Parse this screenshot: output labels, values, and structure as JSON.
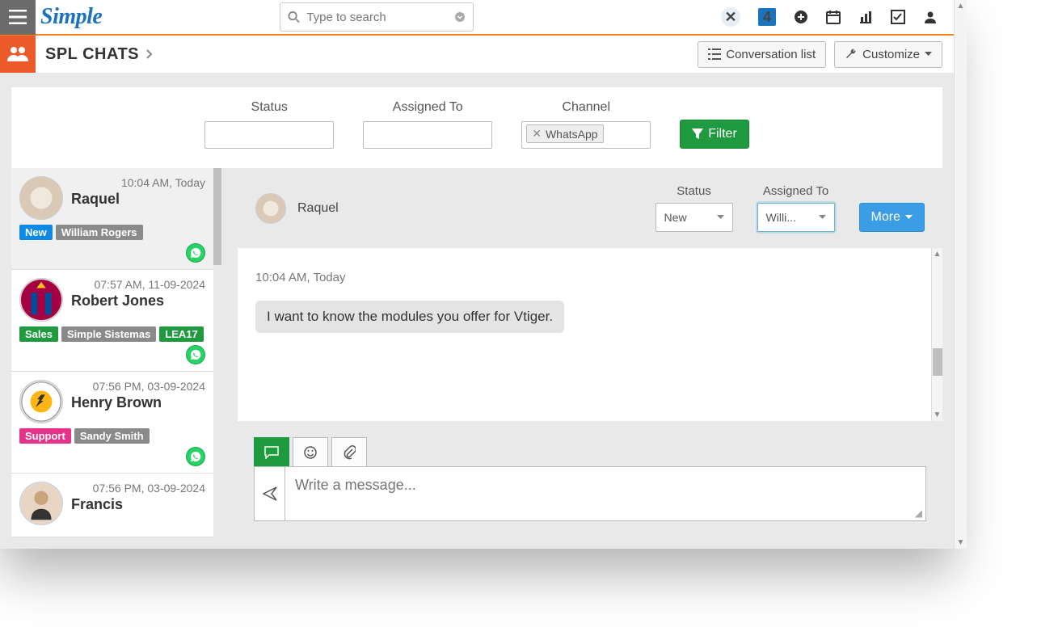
{
  "logo_text": "Simple",
  "search_placeholder": "Type to search",
  "topbar_badge_number": "4",
  "page_title": "SPL CHATS",
  "conversation_list_label": "Conversation list",
  "customize_label": "Customize",
  "filters": {
    "status_label": "Status",
    "assigned_label": "Assigned To",
    "channel_label": "Channel",
    "channel_value": "WhatsApp",
    "filter_button": "Filter"
  },
  "chats": [
    {
      "time": "10:04 AM, Today",
      "name": "Raquel",
      "badges": [
        {
          "text": "New",
          "cls": "b-blue"
        },
        {
          "text": "William Rogers",
          "cls": "b-gray"
        }
      ],
      "whatsapp": true,
      "active": true
    },
    {
      "time": "07:57 AM, 11-09-2024",
      "name": "Robert Jones",
      "badges": [
        {
          "text": "Sales",
          "cls": "b-green"
        },
        {
          "text": "Simple Sistemas",
          "cls": "b-gray"
        },
        {
          "text": "LEA17",
          "cls": "b-green"
        }
      ],
      "whatsapp": true,
      "active": false
    },
    {
      "time": "07:56 PM, 03-09-2024",
      "name": "Henry Brown",
      "badges": [
        {
          "text": "Support",
          "cls": "b-pink"
        },
        {
          "text": "Sandy Smith",
          "cls": "b-gray"
        }
      ],
      "whatsapp": true,
      "active": false
    },
    {
      "time": "07:56 PM, 03-09-2024",
      "name": "Francis",
      "badges": [],
      "whatsapp": false,
      "active": false
    }
  ],
  "conversation": {
    "name": "Raquel",
    "status_label": "Status",
    "status_value": "New",
    "assigned_label": "Assigned To",
    "assigned_value": "Willi...",
    "more_label": "More",
    "message_time": "10:04 AM, Today",
    "message_text": "I want to know the modules you offer for Vtiger.",
    "compose_placeholder": "Write a message..."
  }
}
